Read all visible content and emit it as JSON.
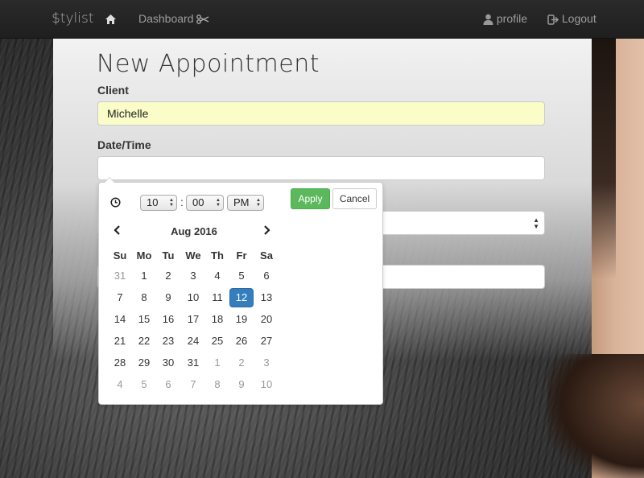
{
  "nav": {
    "brand": "$tylist",
    "dashboard": "Dashboard",
    "profile": "profile",
    "logout": "Logout"
  },
  "form": {
    "title": "New Appointment",
    "client_label": "Client",
    "client_value": "Michelle",
    "datetime_label": "Date/Time",
    "datetime_value": ""
  },
  "picker": {
    "hour": "10",
    "minute": "00",
    "ampm": "PM",
    "apply_label": "Apply",
    "cancel_label": "Cancel",
    "month_label": "Aug 2016",
    "weekdays": [
      "Su",
      "Mo",
      "Tu",
      "We",
      "Th",
      "Fr",
      "Sa"
    ],
    "weeks": [
      [
        {
          "d": "31",
          "off": true
        },
        {
          "d": "1"
        },
        {
          "d": "2"
        },
        {
          "d": "3"
        },
        {
          "d": "4"
        },
        {
          "d": "5"
        },
        {
          "d": "6"
        }
      ],
      [
        {
          "d": "7"
        },
        {
          "d": "8"
        },
        {
          "d": "9"
        },
        {
          "d": "10"
        },
        {
          "d": "11"
        },
        {
          "d": "12",
          "active": true
        },
        {
          "d": "13"
        }
      ],
      [
        {
          "d": "14"
        },
        {
          "d": "15"
        },
        {
          "d": "16"
        },
        {
          "d": "17"
        },
        {
          "d": "18"
        },
        {
          "d": "19"
        },
        {
          "d": "20"
        }
      ],
      [
        {
          "d": "21"
        },
        {
          "d": "22"
        },
        {
          "d": "23"
        },
        {
          "d": "24"
        },
        {
          "d": "25"
        },
        {
          "d": "26"
        },
        {
          "d": "27"
        }
      ],
      [
        {
          "d": "28"
        },
        {
          "d": "29"
        },
        {
          "d": "30"
        },
        {
          "d": "31"
        },
        {
          "d": "1",
          "off": true
        },
        {
          "d": "2",
          "off": true
        },
        {
          "d": "3",
          "off": true
        }
      ],
      [
        {
          "d": "4",
          "off": true
        },
        {
          "d": "5",
          "off": true
        },
        {
          "d": "6",
          "off": true
        },
        {
          "d": "7",
          "off": true
        },
        {
          "d": "8",
          "off": true
        },
        {
          "d": "9",
          "off": true
        },
        {
          "d": "10",
          "off": true
        }
      ]
    ]
  },
  "colors": {
    "apply_green": "#5cb85c",
    "selected_blue": "#357ebd",
    "autofill_yellow": "#fafdc7"
  }
}
